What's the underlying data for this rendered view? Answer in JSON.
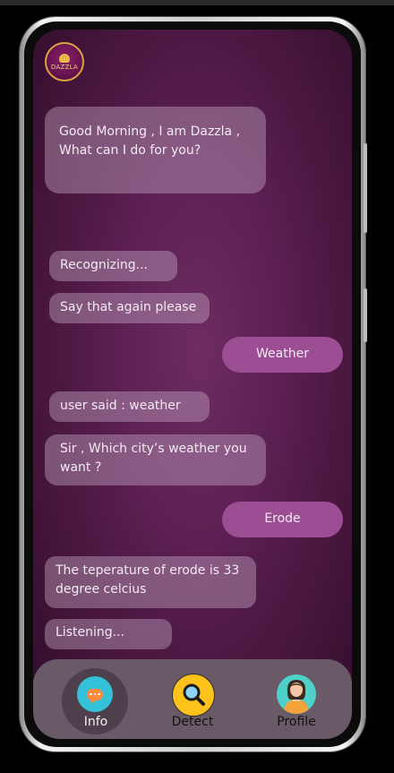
{
  "app": {
    "logo_text": "DAZZLA"
  },
  "chat": {
    "greeting": "Good Morning , I am Dazzla , What can I do for you?",
    "recognizing": "Recognizing...",
    "say_again": "Say that again please",
    "user_weather": "Weather",
    "user_said": "user said : weather",
    "which_city": "Sir , Which city’s weather you want ?",
    "user_erode": "Erode",
    "temperature": "The teperature of erode is 33 degree celcius",
    "listening": "Listening..."
  },
  "nav": {
    "items": [
      {
        "label": "Info",
        "icon": "chat-bubble-icon",
        "active": true
      },
      {
        "label": "Detect",
        "icon": "magnifier-icon",
        "active": false
      },
      {
        "label": "Profile",
        "icon": "user-avatar-icon",
        "active": false
      }
    ]
  },
  "colors": {
    "background": "#5a1f50",
    "bot_bubble": "#a98aa5",
    "user_bubble": "#9b4e93",
    "nav_bar": "#6a5a68",
    "accent_gold": "#d9a441"
  }
}
